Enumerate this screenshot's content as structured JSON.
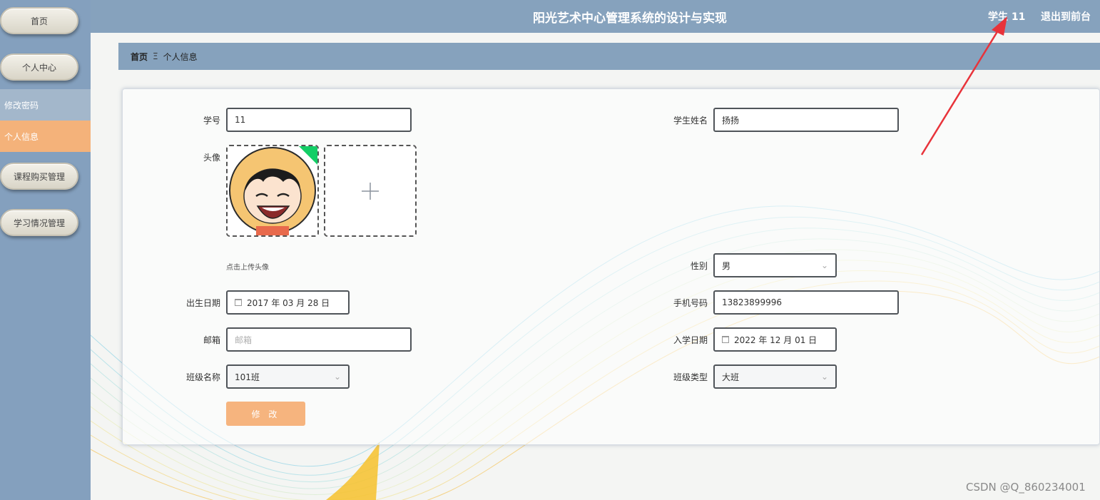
{
  "header": {
    "title": "阳光艺术中心管理系统的设计与实现",
    "user": "学生 11",
    "logout": "退出到前台"
  },
  "sidebar": {
    "items": [
      {
        "label": "首页"
      },
      {
        "label": "个人中心"
      },
      {
        "label": "课程购买管理"
      },
      {
        "label": "学习情况管理"
      }
    ],
    "submenu": [
      {
        "label": "修改密码"
      },
      {
        "label": "个人信息",
        "active": true
      }
    ]
  },
  "breadcrumb": {
    "home": "首页",
    "separator": "Ξ",
    "current": "个人信息"
  },
  "form": {
    "student_id": {
      "label": "学号",
      "value": "11"
    },
    "student_name": {
      "label": "学生姓名",
      "value": "扬扬"
    },
    "avatar": {
      "label": "头像",
      "hint": "点击上传头像"
    },
    "gender": {
      "label": "性别",
      "value": "男"
    },
    "birth_date": {
      "label": "出生日期",
      "value": "2017 年 03 月 28 日"
    },
    "phone": {
      "label": "手机号码",
      "value": "13823899996"
    },
    "email": {
      "label": "邮箱",
      "placeholder": "邮箱"
    },
    "enroll_date": {
      "label": "入学日期",
      "value": "2022 年 12 月 01 日"
    },
    "class_name": {
      "label": "班级名称",
      "value": "101班"
    },
    "class_type": {
      "label": "班级类型",
      "value": "大班"
    },
    "submit": "修 改"
  },
  "colors": {
    "sidebar": "#84a0be",
    "header": "#86a2bd",
    "accent": "#f4b27a",
    "arrow": "#e8333a"
  },
  "icons": [
    "calendar-icon",
    "chevron-down-icon",
    "plus-icon",
    "avatar-image",
    "upload-success-badge"
  ],
  "watermark": "CSDN @Q_860234001"
}
